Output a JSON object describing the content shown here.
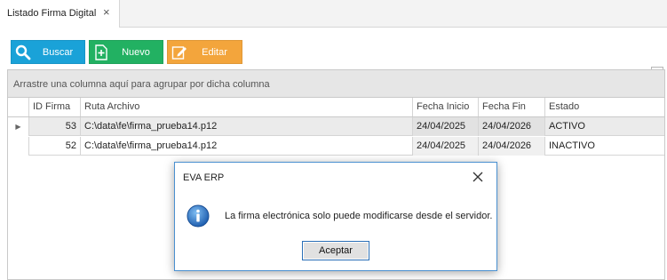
{
  "tab": {
    "label": "Listado Firma Digital",
    "close": "×"
  },
  "toolbar": {
    "buscar": "Buscar",
    "nuevo": "Nuevo",
    "editar": "Editar",
    "colors": {
      "buscar": "#1aa2d8",
      "nuevo": "#22b162",
      "editar": "#f3a53c"
    }
  },
  "grid": {
    "group_hint": "Arrastre una columna aquí para agrupar por dicha columna",
    "columns": [
      "ID Firma",
      "Ruta Archivo",
      "Fecha Inicio",
      "Fecha Fin",
      "Estado"
    ],
    "rows": [
      {
        "id": "53",
        "ruta": "C:\\data\\fe\\firma_prueba14.p12",
        "inicio": "24/04/2025",
        "fin": "24/04/2026",
        "estado": "ACTIVO"
      },
      {
        "id": "52",
        "ruta": "C:\\data\\fe\\firma_prueba14.p12",
        "inicio": "24/04/2025",
        "fin": "24/04/2026",
        "estado": "INACTIVO"
      }
    ]
  },
  "dialog": {
    "title": "EVA ERP",
    "message": "La firma electrónica solo puede modificarse desde el servidor.",
    "ok": "Aceptar",
    "icon": "info-icon"
  }
}
